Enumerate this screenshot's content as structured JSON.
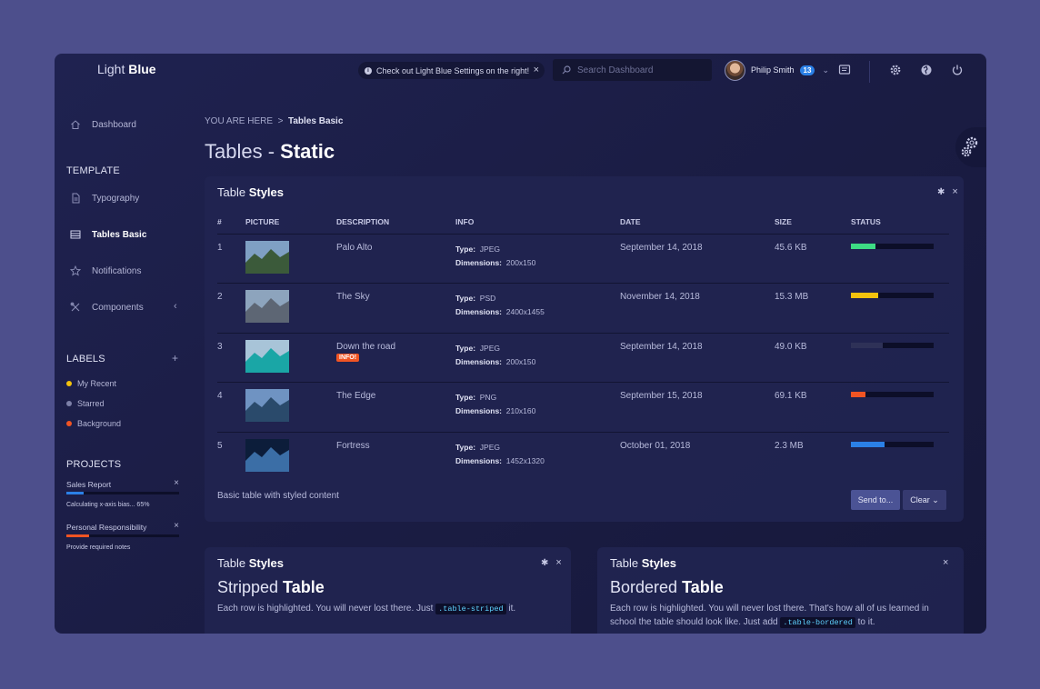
{
  "header": {
    "brand_light": "Light",
    "brand_bold": "Blue",
    "notice_text": "Check out Light Blue Settings on the right!",
    "search_placeholder": "Search Dashboard",
    "user_name": "Philip Smith",
    "user_badge": "13"
  },
  "sidebar": {
    "dashboard": "Dashboard",
    "template_title": "TEMPLATE",
    "items": [
      {
        "label": "Typography"
      },
      {
        "label": "Tables Basic"
      },
      {
        "label": "Notifications"
      },
      {
        "label": "Components"
      }
    ],
    "labels_title": "LABELS",
    "labels": [
      {
        "label": "My Recent",
        "color": "#f4c20d"
      },
      {
        "label": "Starred",
        "color": "#7d80a8"
      },
      {
        "label": "Background",
        "color": "#f05423"
      }
    ],
    "projects_title": "PROJECTS",
    "projects": [
      {
        "name": "Sales Report",
        "note": "Calculating x-axis bias... 65%",
        "progress": 0.15,
        "color": "#2b80e6"
      },
      {
        "name": "Personal Responsibility",
        "note": "Provide required notes",
        "progress": 0.2,
        "color": "#f05423"
      }
    ]
  },
  "breadcrumb": {
    "prefix": "YOU ARE HERE",
    "sep": ">",
    "current": "Tables Basic"
  },
  "page_title": {
    "light": "Tables - ",
    "bold": "Static"
  },
  "table_panel": {
    "title_light": "Table ",
    "title_bold": "Styles",
    "columns": [
      "#",
      "PICTURE",
      "DESCRIPTION",
      "INFO",
      "DATE",
      "SIZE",
      "STATUS"
    ],
    "type_label": "Type:",
    "dim_label": "Dimensions:",
    "rows": [
      {
        "num": "1",
        "desc": "Palo Alto",
        "tag": "",
        "type": "JPEG",
        "dims": "200x150",
        "date": "September 14, 2018",
        "size": "45.6 KB",
        "status": 0.3,
        "status_color": "#3ddc84",
        "thumb": [
          "#7fa0c4",
          "#3b5a3a"
        ]
      },
      {
        "num": "2",
        "desc": "The Sky",
        "tag": "",
        "type": "PSD",
        "dims": "2400x1455",
        "date": "November 14, 2018",
        "size": "15.3 MB",
        "status": 0.33,
        "status_color": "#f4c20d",
        "thumb": [
          "#8da4bd",
          "#5d6674"
        ]
      },
      {
        "num": "3",
        "desc": "Down the road",
        "tag": "INFO!",
        "type": "JPEG",
        "dims": "200x150",
        "date": "September 14, 2018",
        "size": "49.0 KB",
        "status": 0.38,
        "status_color": "#2e3157",
        "thumb": [
          "#a8c4d8",
          "#1aa6a6"
        ]
      },
      {
        "num": "4",
        "desc": "The Edge",
        "tag": "",
        "type": "PNG",
        "dims": "210x160",
        "date": "September 15, 2018",
        "size": "69.1 KB",
        "status": 0.18,
        "status_color": "#f05423",
        "thumb": [
          "#6f93c2",
          "#2a4a6b"
        ]
      },
      {
        "num": "5",
        "desc": "Fortress",
        "tag": "",
        "type": "JPEG",
        "dims": "1452x1320",
        "date": "October 01, 2018",
        "size": "2.3 MB",
        "status": 0.41,
        "status_color": "#2b80e6",
        "thumb": [
          "#0c1d3a",
          "#3b6ea6"
        ]
      }
    ],
    "footer_text": "Basic table with styled content",
    "send_label": "Send to...",
    "clear_label": "Clear"
  },
  "striped_panel": {
    "title_light": "Table ",
    "title_bold": "Styles",
    "heading_light": "Stripped ",
    "heading_bold": "Table",
    "desc": "Each row is highlighted. You will never lost there. Just ",
    "code": ".table-striped",
    "desc_end": " it."
  },
  "bordered_panel": {
    "title_light": "Table ",
    "title_bold": "Styles",
    "heading_light": "Bordered ",
    "heading_bold": "Table",
    "desc": "Each row is highlighted. You will never lost there. That's how all of us learned in school the table should look like. Just add ",
    "code": ".table-bordered",
    "desc_end": " to it."
  }
}
